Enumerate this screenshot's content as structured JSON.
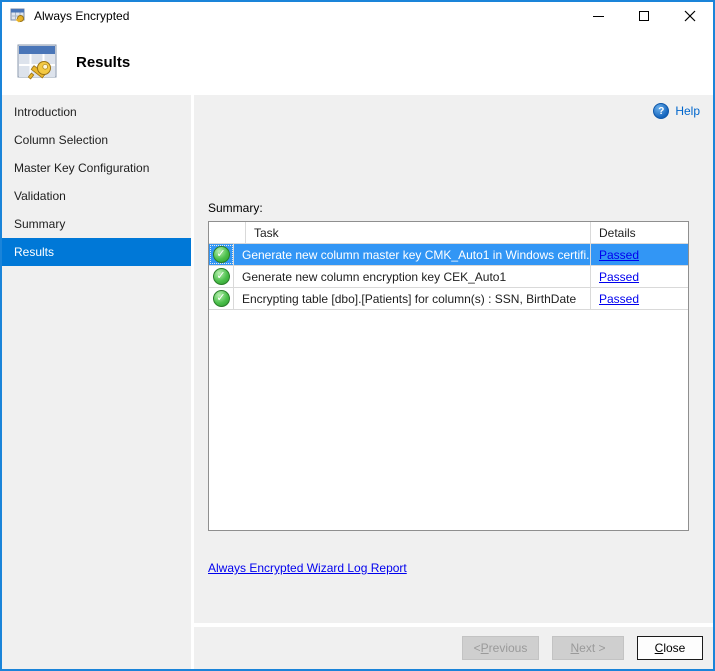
{
  "window": {
    "title": "Always Encrypted"
  },
  "header": {
    "title": "Results"
  },
  "sidebar": {
    "items": [
      {
        "label": "Introduction",
        "selected": false
      },
      {
        "label": "Column Selection",
        "selected": false
      },
      {
        "label": "Master Key Configuration",
        "selected": false
      },
      {
        "label": "Validation",
        "selected": false
      },
      {
        "label": "Summary",
        "selected": false
      },
      {
        "label": "Results",
        "selected": true
      }
    ]
  },
  "content": {
    "help_label": "Help",
    "summary_label": "Summary:",
    "table": {
      "columns": {
        "task": "Task",
        "details": "Details"
      },
      "rows": [
        {
          "status_icon": "green-check",
          "task": "Generate new column master key CMK_Auto1 in Windows certifi...",
          "details": "Passed",
          "selected": true
        },
        {
          "status_icon": "green-check",
          "task": "Generate new column encryption key CEK_Auto1",
          "details": "Passed",
          "selected": false
        },
        {
          "status_icon": "green-check",
          "task": "Encrypting table [dbo].[Patients] for column(s) : SSN, BirthDate",
          "details": "Passed",
          "selected": false
        }
      ]
    },
    "log_link_label": "Always Encrypted Wizard Log Report"
  },
  "footer": {
    "previous": {
      "prefix": "< ",
      "mnemonic": "P",
      "rest": "revious"
    },
    "next": {
      "prefix": "",
      "mnemonic": "N",
      "rest": "ext >"
    },
    "close": {
      "prefix": "",
      "mnemonic": "C",
      "rest": "lose"
    }
  },
  "colors": {
    "window_border": "#1a84d9",
    "sidebar_selected": "#0078d7",
    "row_selected": "#3296f5",
    "link_blue": "#0000ee",
    "help_blue": "#0066cc",
    "success_green": "#2b9a2b",
    "panel_gray": "#f0f0f0"
  }
}
